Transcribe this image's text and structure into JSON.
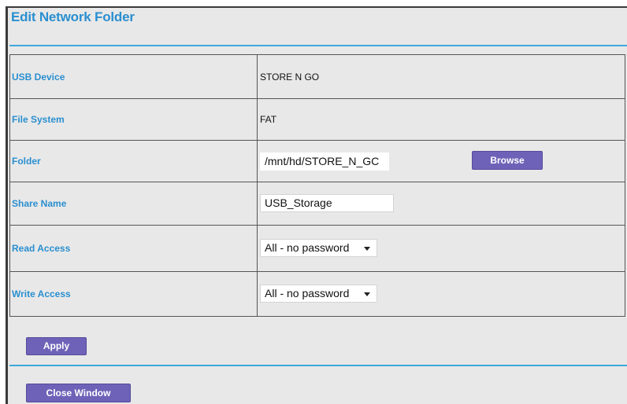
{
  "header": {
    "title": "Edit Network Folder"
  },
  "form": {
    "usb_device": {
      "label": "USB Device",
      "value": "STORE N GO"
    },
    "file_system": {
      "label": "File System",
      "value": "FAT"
    },
    "folder": {
      "label": "Folder",
      "value": "/mnt/hd/STORE_N_GC",
      "browse_label": "Browse"
    },
    "share_name": {
      "label": "Share Name",
      "value": "USB_Storage"
    },
    "read_access": {
      "label": "Read Access",
      "selected": "All - no password"
    },
    "write_access": {
      "label": "Write Access",
      "selected": "All - no password"
    }
  },
  "actions": {
    "apply_label": "Apply",
    "close_label": "Close Window"
  },
  "colors": {
    "label_blue": "#2a8fd0",
    "button_purple": "#6e62b8",
    "rule_blue": "#3da9dd",
    "panel_bg": "#e8e8e8"
  }
}
